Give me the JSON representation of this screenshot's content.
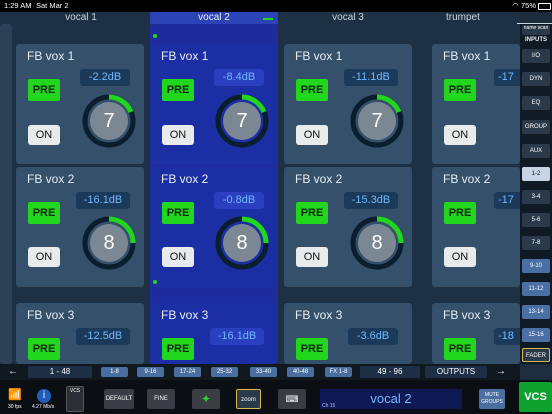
{
  "status": {
    "time": "1:29 AM",
    "date": "Sat Mar 2",
    "battery": "75%"
  },
  "channels": [
    "vocal 1",
    "vocal 2",
    "vocal 3",
    "trumpet"
  ],
  "right_top": {
    "name_scan": "name scan",
    "inputs": "INPUTS"
  },
  "right_buttons": [
    "I/O",
    "DYN",
    "EQ",
    "GROUP",
    "AUX"
  ],
  "right_ranges": [
    "1-2",
    "3-4",
    "5-6",
    "7-8",
    "9-10",
    "11-12",
    "13-14",
    "15-16"
  ],
  "fader": "FADER",
  "panels": {
    "row1": [
      {
        "title": "FB vox 1",
        "value": "-2.2dB",
        "knob": "7",
        "pre": "PRE",
        "on": "ON"
      },
      {
        "title": "FB vox 1",
        "value": "-8.4dB",
        "knob": "7",
        "pre": "PRE",
        "on": "ON"
      },
      {
        "title": "FB vox 1",
        "value": "-11.1dB",
        "knob": "7",
        "pre": "PRE",
        "on": "ON"
      },
      {
        "title": "FB vox 1",
        "value": "-17",
        "knob": "",
        "pre": "PRE",
        "on": "ON"
      }
    ],
    "row2": [
      {
        "title": "FB vox 2",
        "value": "-16.1dB",
        "knob": "8",
        "pre": "PRE",
        "on": "ON"
      },
      {
        "title": "FB vox 2",
        "value": "-0.8dB",
        "knob": "8",
        "pre": "PRE",
        "on": "ON"
      },
      {
        "title": "FB vox 2",
        "value": "-15.3dB",
        "knob": "8",
        "pre": "PRE",
        "on": "ON"
      },
      {
        "title": "FB vox 2",
        "value": "-17",
        "knob": "",
        "pre": "PRE",
        "on": "ON"
      }
    ],
    "row3": [
      {
        "title": "FB vox 3",
        "value": "-12.5dB",
        "pre": "PRE"
      },
      {
        "title": "FB vox 3",
        "value": "-16.1dB",
        "pre": "PRE"
      },
      {
        "title": "FB vox 3",
        "value": "-3.6dB",
        "pre": "PRE"
      },
      {
        "title": "FB vox 3",
        "value": "-18",
        "pre": "PRE"
      }
    ]
  },
  "nav": {
    "range1": "1 - 48",
    "b1": "1-8",
    "b2": "9-16",
    "b3": "17-24",
    "b4": "25-32",
    "b5": "33-40",
    "b6": "40-48",
    "b7": "FX 1-8",
    "range2": "49 - 96",
    "outputs": "OUTPUTS"
  },
  "bottom": {
    "fps": "30 fps",
    "rate": "4.27 Mb/s",
    "vcs1": "VCS",
    "default": "DEFAULT",
    "fine": "FINE",
    "zoom": "zoom",
    "channel": "vocal 2",
    "ch": "Ch 15",
    "mute": "MUTE GROUPS",
    "vcs2": "VCS"
  }
}
